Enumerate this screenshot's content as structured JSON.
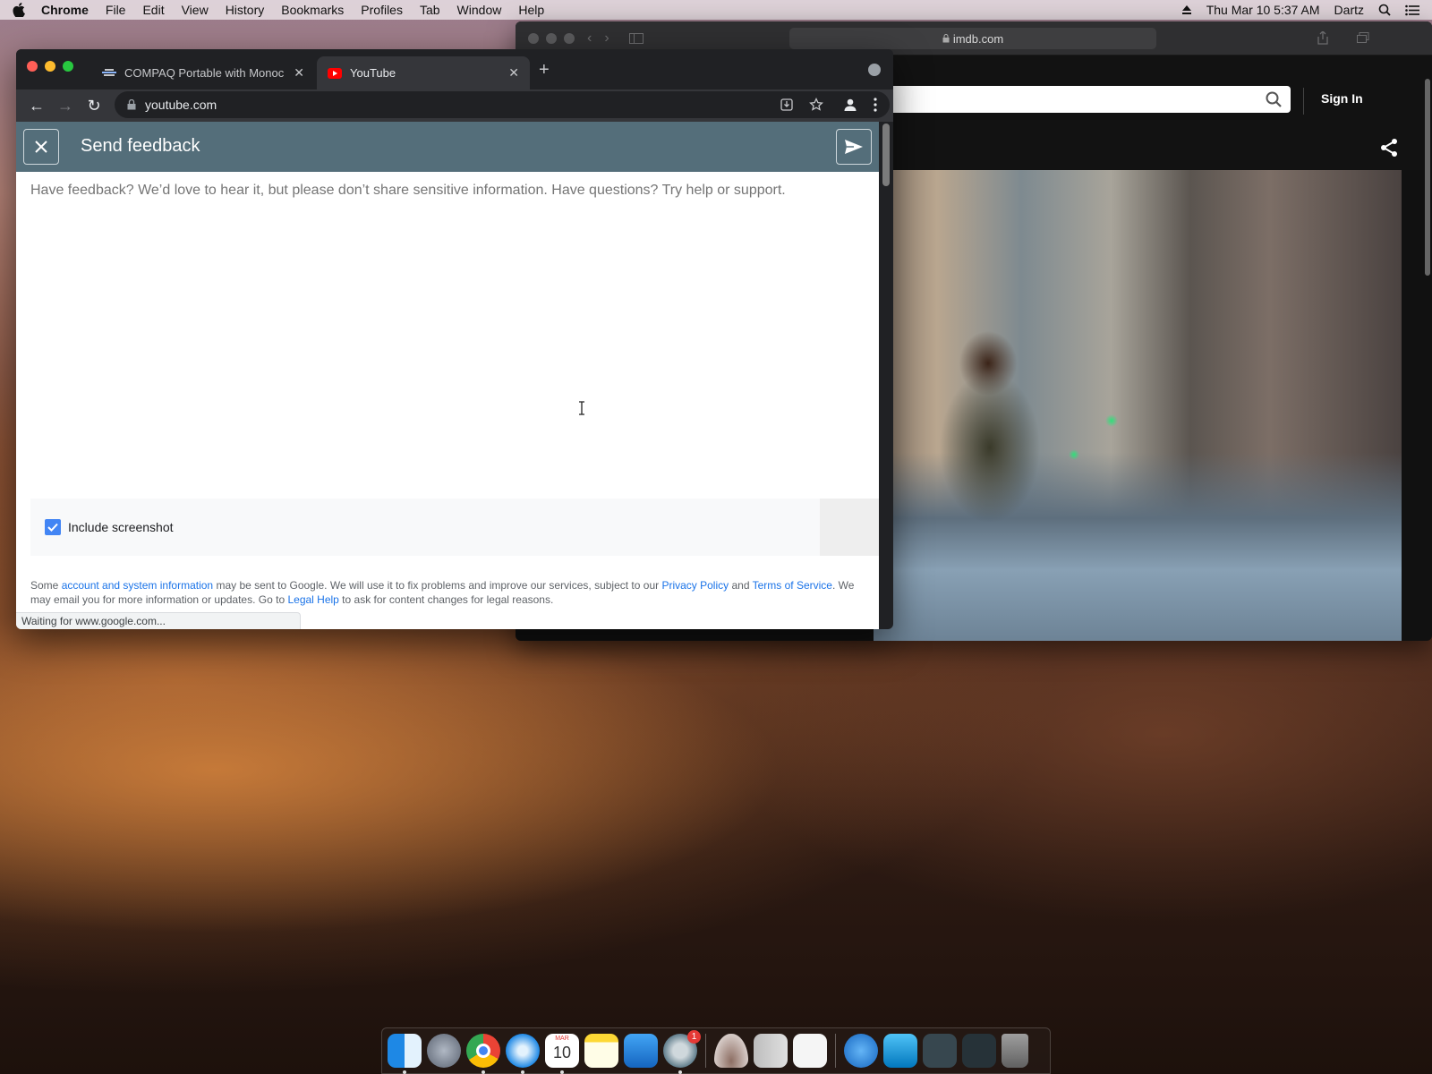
{
  "menubar": {
    "app": "Chrome",
    "items": [
      "File",
      "Edit",
      "View",
      "History",
      "Bookmarks",
      "Profiles",
      "Tab",
      "Window",
      "Help"
    ],
    "clock": "Thu Mar 10  5:37 AM",
    "user": "Dartz"
  },
  "safari": {
    "url": "imdb.com",
    "sign_in": "Sign In"
  },
  "chrome": {
    "tabs": [
      {
        "title": "COMPAQ Portable with Monoc"
      },
      {
        "title": "YouTube"
      }
    ],
    "url": "youtube.com",
    "status": "Waiting for www.google.com..."
  },
  "feedback": {
    "title": "Send feedback",
    "placeholder": "Have feedback? We’d love to hear it, but please don’t share sensitive information. Have questions? Try help or support.",
    "include_screenshot": "Include screenshot",
    "legal": {
      "p1": "Some ",
      "l1": "account and system information",
      "p2": " may be sent to Google. We will use it to fix problems and improve our services, subject to our ",
      "l2": "Privacy Policy",
      "p3": " and ",
      "l3": "Terms of Service",
      "p4": ". We may email you for more information or updates. Go to ",
      "l4": "Legal Help",
      "p5": " to ask for content changes for legal reasons."
    }
  },
  "dock": {
    "calendar_month": "MAR",
    "calendar_day": "10",
    "settings_badge": "1"
  },
  "colors": {
    "feedback_header": "#546e7a",
    "link": "#1a73e8",
    "checkbox": "#4285f4"
  }
}
